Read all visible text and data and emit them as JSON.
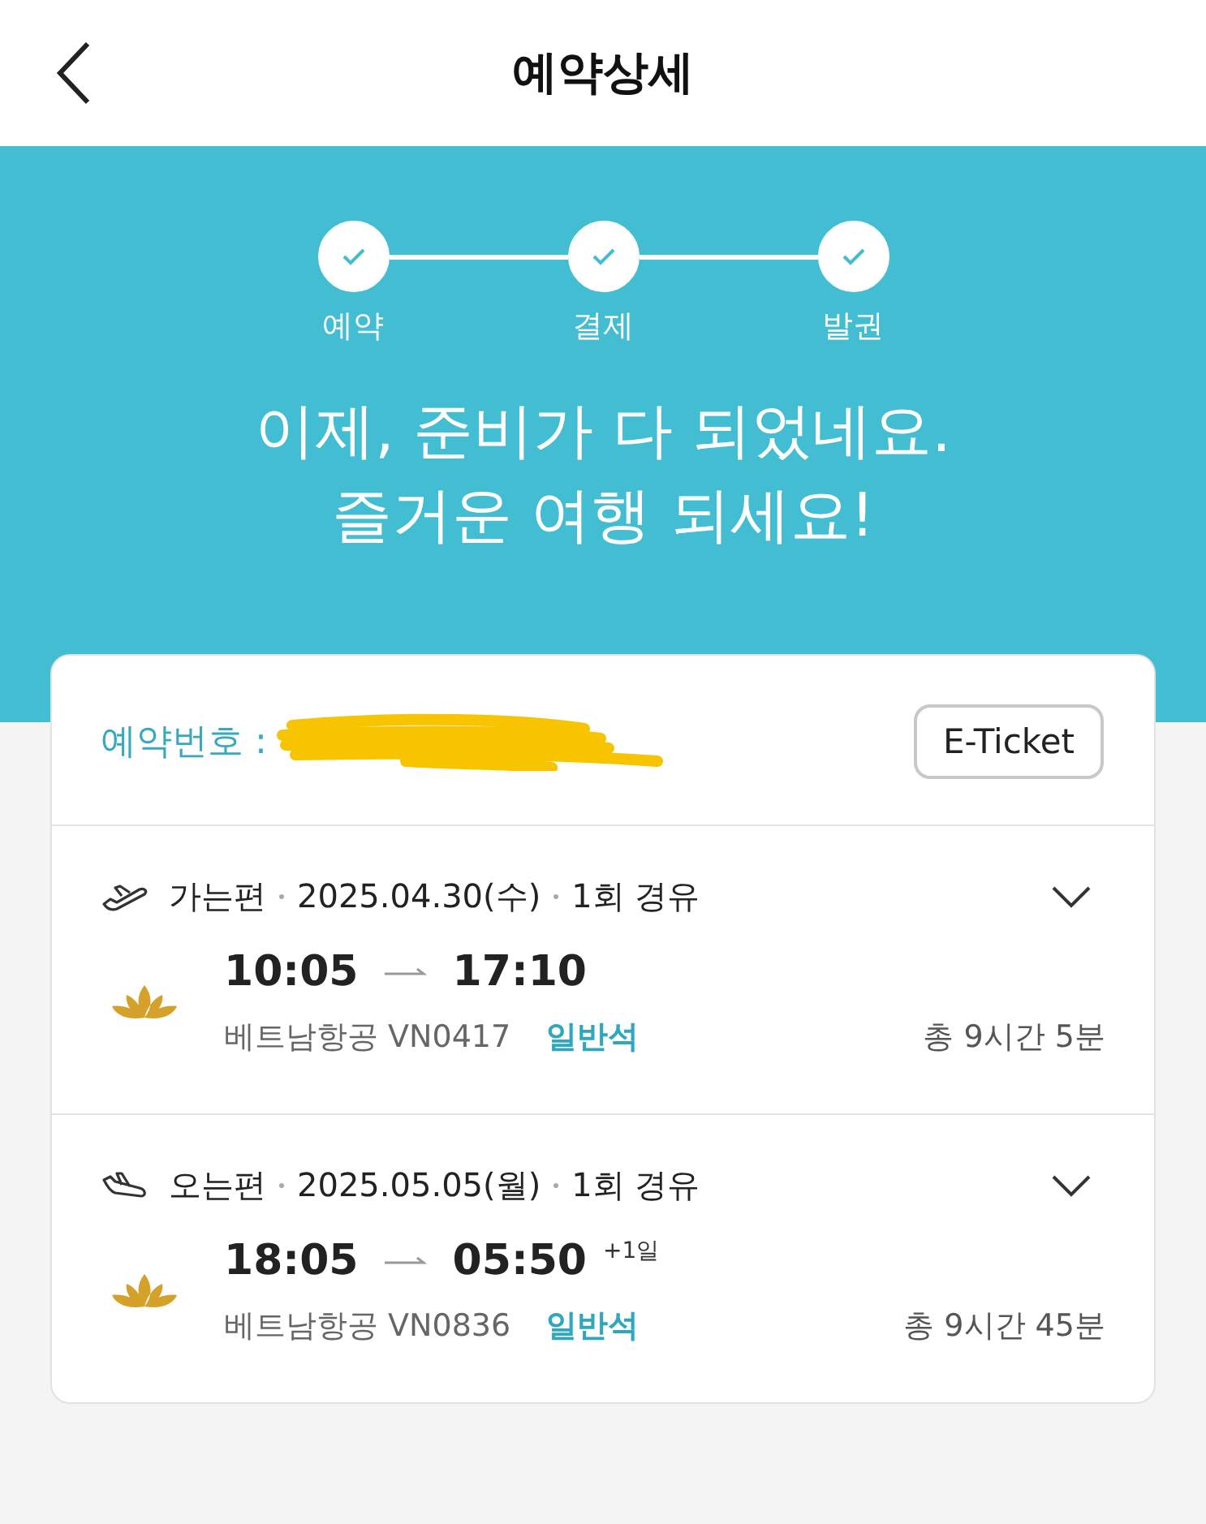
{
  "header": {
    "title": "예약상세"
  },
  "progress": {
    "steps": [
      {
        "label": "예약",
        "done": true
      },
      {
        "label": "결제",
        "done": true
      },
      {
        "label": "발권",
        "done": true
      }
    ]
  },
  "headline": [
    "이제, 준비가 다 되었네요.",
    "즐거운 여행 되세요!"
  ],
  "booking": {
    "label": "예약번호 :",
    "redacted": true,
    "button": "E-Ticket"
  },
  "flights": [
    {
      "kind": "outbound",
      "direction": "가는편",
      "date": "2025.04.30(수)",
      "stops": "1회 경유",
      "expanded": false,
      "depart": "10:05",
      "arrive": "17:10",
      "airline_flight": "베트남항공 VN0417",
      "cabin": "일반석",
      "duration": "총 9시간 5분"
    },
    {
      "kind": "return",
      "direction": "오는편",
      "date": "2025.05.05(월)",
      "stops": "1회 경유",
      "expanded": false,
      "depart": "18:05",
      "arrive": "05:50",
      "arrive_note": "+1일",
      "airline_flight": "베트남항공 VN0836",
      "cabin": "일반석",
      "duration": "총 9시간 45분"
    }
  ]
}
